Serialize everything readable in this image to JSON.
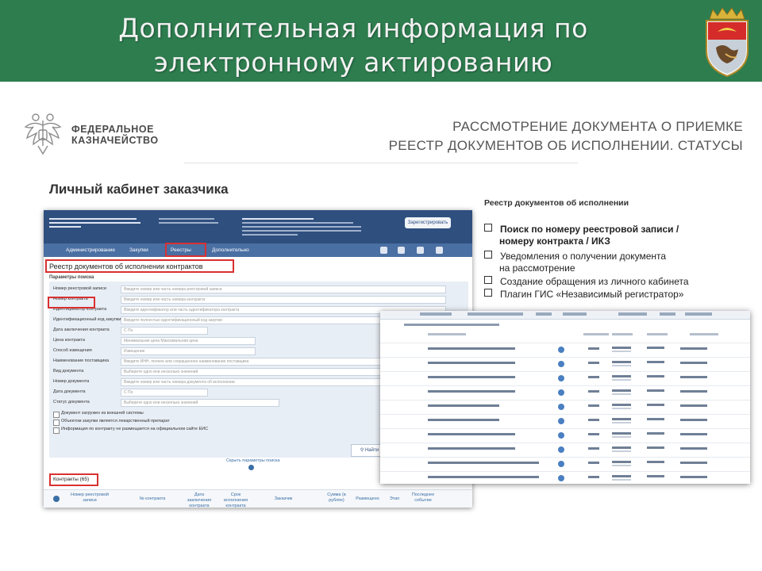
{
  "slide": {
    "title_line1": "Дополнительная информация по",
    "title_line2": "электронному актированию",
    "accent_color": "#2e7d4f"
  },
  "brand": {
    "line1": "ФЕДЕРАЛЬНОЕ",
    "line2": "КАЗНАЧЕЙСТВО",
    "logo_icon": "double-headed-eagle-icon"
  },
  "header_right": {
    "line1": "РАССМОТРЕНИЕ ДОКУМЕНТА О ПРИЕМКЕ",
    "line2": "РЕЕСТР ДОКУМЕНТОВ ОБ ИСПОЛНЕНИИ. СТАТУСЫ"
  },
  "section_title": "Личный кабинет заказчика",
  "cabinet_screen": {
    "nav": {
      "administration": "Администрирование",
      "purchases": "Закупки",
      "registries": "Реестры",
      "additional": "Дополнительно"
    },
    "register_button": "Зарегистрировать",
    "heading": "Реестр документов об исполнении контрактов",
    "params_label": "Параметры поиска",
    "fields": [
      {
        "label": "Номер реестровой записи",
        "placeholder": "Введите номер или часть номера реестровой записи"
      },
      {
        "label": "Номер контракта",
        "placeholder": "Введите номер или часть номера контракта"
      },
      {
        "label": "Идентификатор контракта",
        "placeholder": "Введите идентификатор или часть идентификатора контракта"
      },
      {
        "label": "Идентификационный код закупки",
        "placeholder": "Введите полностью идентификационный код закупки"
      },
      {
        "label": "Дата заключения контракта",
        "placeholder": "С          По"
      },
      {
        "label": "Цена контракта",
        "placeholder": "Минимальная цена          Максимальная цена"
      },
      {
        "label": "Способ извещения",
        "placeholder": "Извещение"
      },
      {
        "label": "Наименование поставщика",
        "placeholder": "Введите ИНН, полное или сокращенное наименование поставщика"
      },
      {
        "label": "Вид документа",
        "placeholder": "Выберите одно или несколько значений"
      },
      {
        "label": "Номер документа",
        "placeholder": "Введите номер или часть номера документа об исполнении"
      },
      {
        "label": "Дата документа",
        "placeholder": "С          По"
      },
      {
        "label": "Статус документа",
        "placeholder": "Выберите одно или несколько значений"
      }
    ],
    "checkbox1": "Документ загружен из внешней системы",
    "checkbox2": "Объектом закупки является лекарственный препарат",
    "checkbox3": "Информация по контракту не размещается на официальном сайте ЕИС",
    "find_button": "Найти",
    "hide_params": "Скрыть параметры поиска",
    "contracts_tab": "Контракты (65)",
    "columns": [
      "Номер реестровой записи",
      "№ контракта",
      "Дата заключения контракта",
      "Срок исполнения контракта",
      "Заказчик",
      "Сумма (в рублях)",
      "Размещено",
      "Этап",
      "Последнее событие"
    ]
  },
  "registry_info": {
    "title": "Реестр документов об исполнении",
    "bullets": [
      {
        "bold": true,
        "text": "Поиск по номеру реестровой записи / номеру контракта / ИКЗ",
        "l1": "Поиск по номеру реестровой записи /",
        "l2": "номеру контракта / ИКЗ"
      },
      {
        "bold": false,
        "text": "Уведомления о получении документа на рассмотрение",
        "l1": "Уведомления о получении документа",
        "l2": "на рассмотрение"
      },
      {
        "bold": false,
        "text": "Создание обращения из личного кабинета",
        "l1": "Создание обращения из личного кабинета",
        "l2": ""
      },
      {
        "bold": false,
        "text": "Плагин ГИС «Независимый регистратор»",
        "l1": "Плагин ГИС «Независимый регистратор»",
        "l2": ""
      }
    ]
  },
  "colors": {
    "cabinet_header": "#2f4f7f",
    "cabinet_nav": "#4a6fa3",
    "highlight": "#d93030"
  }
}
